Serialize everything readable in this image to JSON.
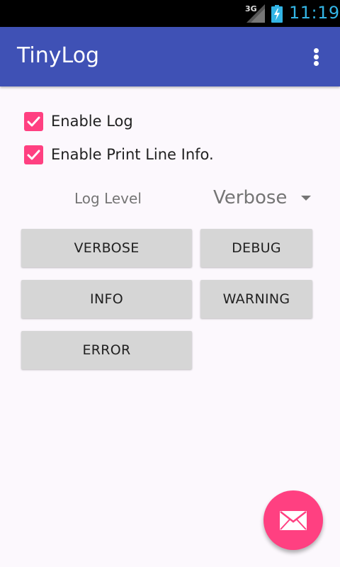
{
  "status_bar": {
    "network": "3G",
    "time": "11:19",
    "icons": [
      "signal-icon",
      "battery-charging-icon"
    ]
  },
  "app_bar": {
    "title": "TinyLog",
    "menu_icon": "overflow-menu-icon"
  },
  "settings": {
    "enable_log": {
      "label": "Enable Log",
      "checked": true
    },
    "enable_print_line_info": {
      "label": "Enable Print Line Info.",
      "checked": true
    }
  },
  "log_level": {
    "label": "Log Level",
    "selected": "Verbose"
  },
  "buttons": {
    "verbose": "VERBOSE",
    "debug": "DEBUG",
    "info": "INFO",
    "warning": "WARNING",
    "error": "ERROR"
  },
  "fab": {
    "icon": "email-icon"
  },
  "colors": {
    "primary": "#3f51b5",
    "accent": "#ff4081",
    "status_time": "#33b5e5"
  }
}
